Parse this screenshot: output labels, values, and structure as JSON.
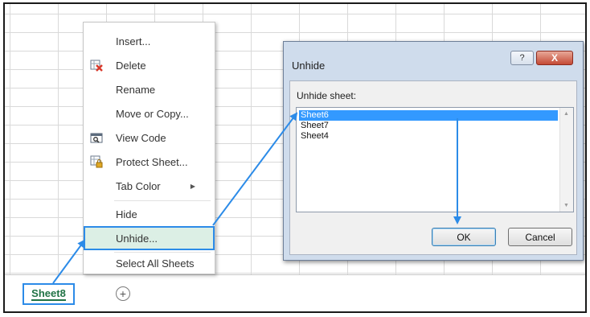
{
  "context_menu": {
    "items": [
      {
        "label": "Insert...",
        "icon": ""
      },
      {
        "label": "Delete",
        "icon": "delete-sheet-icon"
      },
      {
        "label": "Rename",
        "icon": ""
      },
      {
        "label": "Move or Copy...",
        "icon": ""
      },
      {
        "label": "View Code",
        "icon": "view-code-icon"
      },
      {
        "label": "Protect Sheet...",
        "icon": "protect-sheet-icon"
      },
      {
        "label": "Tab Color",
        "icon": "",
        "submenu": true
      },
      {
        "label": "Hide",
        "icon": ""
      },
      {
        "label": "Unhide...",
        "icon": "",
        "highlighted": true
      },
      {
        "label": "Select All Sheets",
        "icon": ""
      }
    ]
  },
  "sheet_tabs": {
    "active": "Sheet8",
    "add_icon": "new-sheet-plus-icon"
  },
  "unhide_dialog": {
    "title": "Unhide",
    "help": "?",
    "close": "X",
    "list_label": "Unhide sheet:",
    "sheets": [
      "Sheet6",
      "Sheet7",
      "Sheet4"
    ],
    "selected": "Sheet6",
    "ok_label": "OK",
    "cancel_label": "Cancel"
  },
  "colors": {
    "accent_blue": "#2c8be8",
    "selection_blue": "#3399ff",
    "excel_green": "#217346",
    "menu_highlight": "#dcefe5",
    "dialog_frame": "#cfdcec"
  }
}
